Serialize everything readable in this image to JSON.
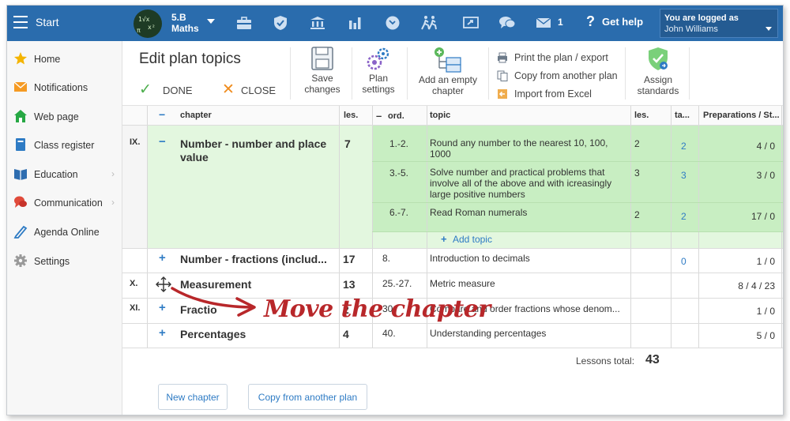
{
  "header": {
    "start_label": "Start",
    "class_line1": "5.B",
    "class_line2": "Maths",
    "messages_count": "1",
    "help_label": "Get help",
    "login_title": "You are logged as",
    "login_user": "John Williams"
  },
  "sidebar": {
    "items": [
      {
        "label": "Home",
        "icon": "star-icon"
      },
      {
        "label": "Notifications",
        "icon": "envelope-icon"
      },
      {
        "label": "Web page",
        "icon": "house-icon"
      },
      {
        "label": "Class register",
        "icon": "register-icon"
      },
      {
        "label": "Education",
        "icon": "book-icon"
      },
      {
        "label": "Communication",
        "icon": "chat-icon"
      },
      {
        "label": "Agenda Online",
        "icon": "pen-icon"
      },
      {
        "label": "Settings",
        "icon": "gear-icon"
      }
    ]
  },
  "toolbar": {
    "title": "Edit plan topics",
    "done": "DONE",
    "close": "CLOSE",
    "save_l1": "Save",
    "save_l2": "changes",
    "plan_l1": "Plan",
    "plan_l2": "settings",
    "add_l1": "Add an empty",
    "add_l2": "chapter",
    "print": "Print the plan / export",
    "copy": "Copy from another plan",
    "import": "Import from Excel",
    "assign_l1": "Assign",
    "assign_l2": "standards"
  },
  "table": {
    "headers": {
      "chapter": "chapter",
      "les": "les.",
      "ord": "ord.",
      "topic": "topic",
      "les2": "les.",
      "ta": "ta...",
      "prep": "Preparations / St..."
    },
    "chapters": [
      {
        "roman": "IX.",
        "sign": "−",
        "name_l1": "Number - number and place",
        "name_l2": "value",
        "les": "7",
        "topics": [
          {
            "ord": "1.-2.",
            "t1": "Round any number to the nearest 10, 100,",
            "t2": "1000",
            "t3": "",
            "les": "2",
            "ta": "2",
            "prep": "4 / 0"
          },
          {
            "ord": "3.-5.",
            "t1": "Solve number and practical problems that",
            "t2": "involve all of the above and with icreasingly",
            "t3": "large positive numbers",
            "les": "3",
            "ta": "3",
            "prep": "3 / 0"
          },
          {
            "ord": "6.-7.",
            "t1": "Read Roman numerals",
            "t2": "",
            "t3": "",
            "les": "2",
            "ta": "2",
            "prep": "17 / 0"
          }
        ],
        "add_topic": "Add topic"
      },
      {
        "roman": "",
        "sign": "+",
        "name_l1": "Number - fractions (includ...",
        "les": "17",
        "ord": "8.",
        "topic": "Introduction to decimals",
        "les2": "",
        "ta": "0",
        "prep": "1 / 0"
      },
      {
        "roman": "X.",
        "sign": "",
        "name_l1": "Measurement",
        "les": "13",
        "ord": "25.-27.",
        "topic": "Metric measure",
        "les2": "",
        "ta": "",
        "prep": "8 / 4 / 23"
      },
      {
        "roman": "XI.",
        "sign": "+",
        "name_l1": "Fractio",
        "les": "2",
        "ord": "30.",
        "topic": "Compare and order fractions whose denom...",
        "les2": "",
        "ta": "",
        "prep": "1 / 0"
      },
      {
        "roman": "",
        "sign": "+",
        "name_l1": "Percentages",
        "les": "4",
        "ord": "40.",
        "topic": "Understanding percentages",
        "les2": "",
        "ta": "",
        "prep": "5 / 0"
      }
    ]
  },
  "footer": {
    "lessons_total_label": "Lessons total:",
    "lessons_total_value": "43",
    "new_chapter": "New chapter",
    "copy_plan": "Copy from another plan"
  },
  "annotation": {
    "text": "Move the chapter"
  },
  "colors": {
    "topbar": "#2a6cad",
    "selected_row": "#e3f7df",
    "link": "#2e7bc4",
    "annotation": "#b8272a"
  }
}
